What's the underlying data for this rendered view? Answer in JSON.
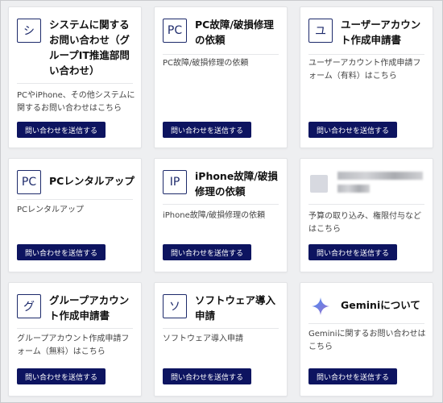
{
  "button_label": "問い合わせを送信する",
  "cards": [
    {
      "icon_char": "シ",
      "icon_name": "system-icon",
      "title": "システムに関するお問い合わせ（グループIT推進部問い合わせ）",
      "description": "PCやiPhone、その他システムに関するお問い合わせはこちら"
    },
    {
      "icon_char": "PC",
      "icon_name": "pc-icon",
      "title": "PC故障/破損修理の依頼",
      "description": "PC故障/破損修理の依頼"
    },
    {
      "icon_char": "ユ",
      "icon_name": "user-account-icon",
      "title": "ユーザーアカウント作成申請書",
      "description": "ユーザーアカウント作成申請フォーム（有料）はこちら"
    },
    {
      "icon_char": "PC",
      "icon_name": "pc-icon",
      "title": "PCレンタルアップ",
      "description": "PCレンタルアップ"
    },
    {
      "icon_char": "IP",
      "icon_name": "iphone-icon",
      "title": "iPhone故障/破損修理の依頼",
      "description": "iPhone故障/破損修理の依頼"
    },
    {
      "icon_char": "",
      "icon_name": "blurred-icon",
      "title": "",
      "description": "予算の取り込み、権限付与などはこちら"
    },
    {
      "icon_char": "グ",
      "icon_name": "group-account-icon",
      "title": "グループアカウント作成申請書",
      "description": "グループアカウント作成申請フォーム（無料）はこちら"
    },
    {
      "icon_char": "ソ",
      "icon_name": "software-icon",
      "title": "ソフトウェア導入申請",
      "description": "ソフトウェア導入申請"
    },
    {
      "icon_char": "",
      "icon_name": "gemini-star-icon",
      "title": "Geminiについて",
      "description": "Geminiに関するお問い合わせはこちら"
    }
  ],
  "colors": {
    "accent": "#1d2a6b",
    "button_bg": "#0d1460",
    "gemini_a": "#4a8bf5",
    "gemini_b": "#9b72cb"
  }
}
